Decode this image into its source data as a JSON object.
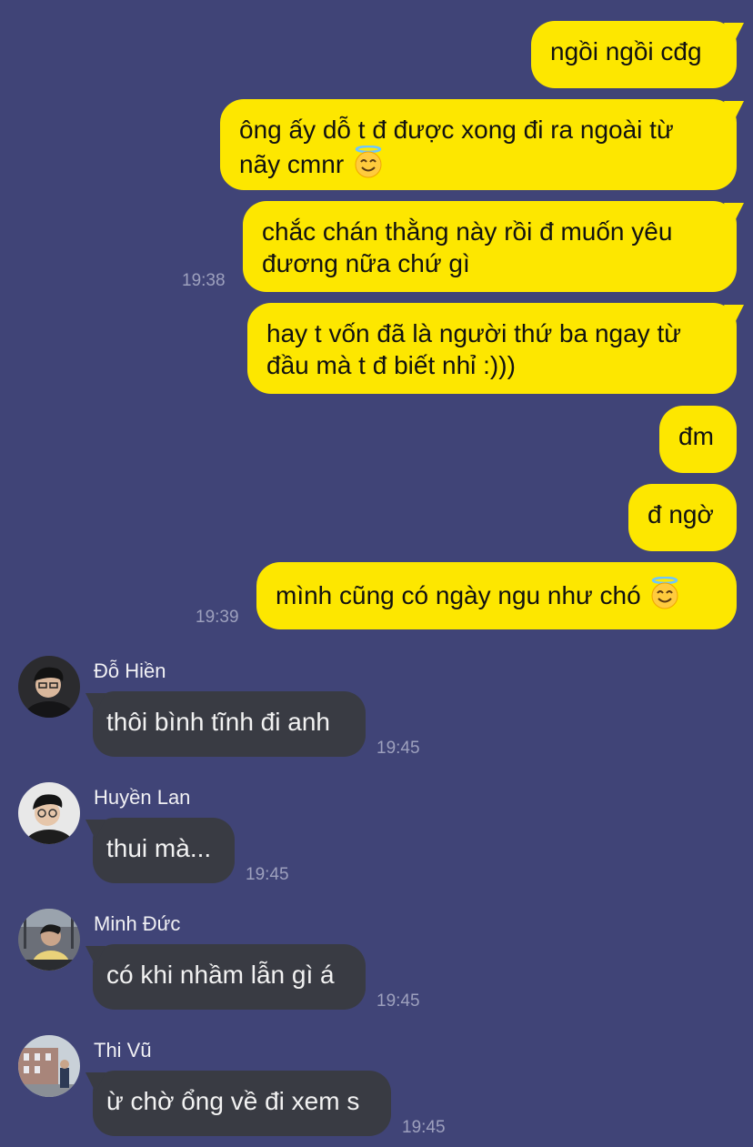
{
  "outgoing": [
    {
      "text": "ngồi ngồi cđg"
    },
    {
      "line1": "ông ấy dỗ t đ được xong đi ra ngoài từ",
      "line2": "nãy cmnr",
      "emoji": "smiling-face-with-halo"
    },
    {
      "line1": "chắc chán thằng này rồi đ muốn yêu",
      "line2": "đương nữa chứ gì",
      "time": "19:38"
    },
    {
      "line1": "hay t vốn đã là người thứ ba ngay từ",
      "line2": "đầu mà t đ biết nhỉ :)))"
    },
    {
      "text": "đm"
    },
    {
      "text": "đ ngờ"
    },
    {
      "text": "mình cũng có ngày ngu như chó",
      "emoji": "smiling-face-with-halo",
      "time": "19:39"
    }
  ],
  "incoming": [
    {
      "sender": "Đỗ Hiền",
      "text": "thôi bình tĩnh đi anh",
      "time": "19:45"
    },
    {
      "sender": "Huyền Lan",
      "text": "thui mà...",
      "time": "19:45"
    },
    {
      "sender": "Minh Đức",
      "text": "có khi nhầm lẫn gì á",
      "time": "19:45"
    },
    {
      "sender": "Thi Vũ",
      "text": "ừ chờ ổng về đi xem s",
      "time": "19:45"
    }
  ],
  "colors": {
    "background": "#404477",
    "outgoing_bubble": "#fde700",
    "incoming_bubble": "#393b43",
    "timestamp": "#9da0bd"
  }
}
